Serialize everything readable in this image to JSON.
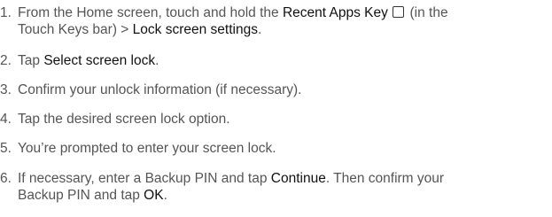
{
  "steps": [
    {
      "number": "1.",
      "l1_a": "From the Home screen, touch and hold the ",
      "l1_b": "Recent Apps Key",
      "l1_c": " (in the",
      "l2_a": "Touch Keys bar) > ",
      "l2_b": "Lock screen settings",
      "l2_c": "."
    },
    {
      "number": "2.",
      "a": "Tap ",
      "b": "Select screen lock",
      "c": "."
    },
    {
      "number": "3.",
      "text": "Confirm your unlock information (if necessary)."
    },
    {
      "number": "4.",
      "text": "Tap the desired screen lock option."
    },
    {
      "number": "5.",
      "text": "You’re prompted to enter your screen lock."
    },
    {
      "number": "6.",
      "l1_a": "If necessary, enter a Backup PIN and tap ",
      "l1_b": "Continue",
      "l1_c": ". Then confirm your",
      "l2_a": "Backup PIN and tap ",
      "l2_b": "OK",
      "l2_c": "."
    }
  ],
  "icons": {
    "recent_apps_key": "recent-apps-square-icon"
  }
}
